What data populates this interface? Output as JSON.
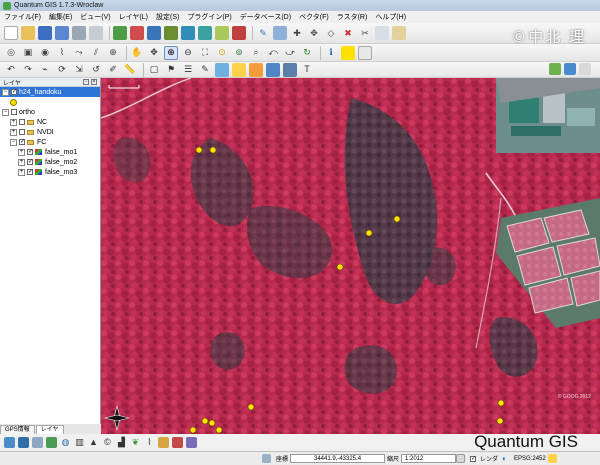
{
  "window": {
    "title": "Quantum GIS 1.7.3-Wroclaw"
  },
  "menu": [
    "ファイル(F)",
    "編集(E)",
    "ビュー(V)",
    "レイヤ(L)",
    "設定(S)",
    "プラグイン(P)",
    "データベース(D)",
    "ベクタ(F)",
    "ラスタ(R)",
    "ヘルプ(H)"
  ],
  "watermark": "©中北 理",
  "brand": "Quantum GIS",
  "layers_panel": {
    "title": "レイヤ",
    "layers": [
      {
        "name": "h24_handoku",
        "checked": true,
        "selected": true,
        "type": "point",
        "expander": "−"
      },
      {
        "name": "ortho",
        "checked": false,
        "type": "group",
        "expander": "−"
      },
      {
        "name": "NC",
        "checked": false,
        "type": "raster",
        "expander": "+"
      },
      {
        "name": "NVDI",
        "checked": false,
        "type": "raster",
        "expander": "+"
      },
      {
        "name": "FC",
        "checked": true,
        "type": "raster",
        "expander": "−"
      },
      {
        "name": "false_mo1",
        "checked": true,
        "type": "raster",
        "expander": "+"
      },
      {
        "name": "false_mo2",
        "checked": true,
        "type": "raster",
        "expander": "+"
      },
      {
        "name": "false_mo3",
        "checked": true,
        "type": "raster",
        "expander": "+"
      }
    ],
    "tabs": [
      "GPS情報",
      "レイヤ"
    ]
  },
  "map": {
    "copyright": "© GOOG 2012",
    "sample_points": 12
  },
  "statusbar": {
    "coord_label": "座標",
    "coord_value": "34441.9,-43325.4",
    "scale_label": "縮尺",
    "scale_value": "1:2012",
    "render_label": "レンダ",
    "crs": "EPSG:2452"
  },
  "colors": {
    "map_base": "#b42a4a",
    "point_fill": "#ffe100",
    "selection": "#3074d8"
  }
}
